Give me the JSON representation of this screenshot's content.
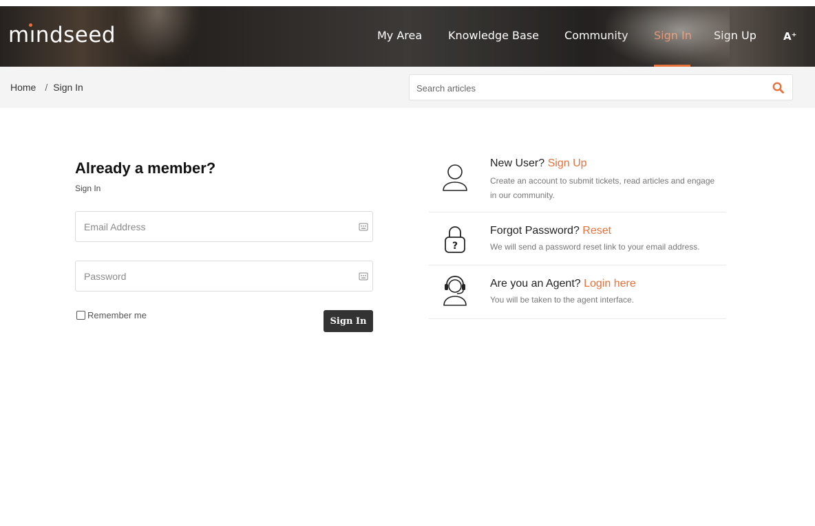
{
  "header": {
    "logo": "mındseed",
    "nav": [
      {
        "label": "My Area"
      },
      {
        "label": "Knowledge Base"
      },
      {
        "label": "Community"
      },
      {
        "label": "Sign In"
      },
      {
        "label": "Sign Up"
      }
    ],
    "accessibility_label": "A⁺",
    "accent_color": "#e8703a"
  },
  "breadcrumb": {
    "home": "Home",
    "separator": "/",
    "current": "Sign In"
  },
  "search": {
    "placeholder": "Search articles",
    "value": "",
    "icon": "search-icon"
  },
  "form": {
    "title": "Already a member?",
    "subtitle": "Sign In",
    "email_placeholder": "Email Address",
    "password_placeholder": "Password",
    "field_icon": "keyboard-icon",
    "remember_label": "Remember me",
    "remember_checked": false,
    "submit_label": "Sign In",
    "button_color": "#333333"
  },
  "info": [
    {
      "title": "New User?",
      "link": "Sign Up",
      "description": "Create an account to submit tickets, read articles and engage in our community.",
      "icon": "user-icon"
    },
    {
      "title": "Forgot Password?",
      "link": "Reset",
      "description": "We will send a password reset link to your email address.",
      "icon": "lock-question-icon"
    },
    {
      "title": "Are you an Agent?",
      "link": "Login here",
      "description": "You will be taken to the agent interface.",
      "icon": "headset-agent-icon"
    }
  ]
}
